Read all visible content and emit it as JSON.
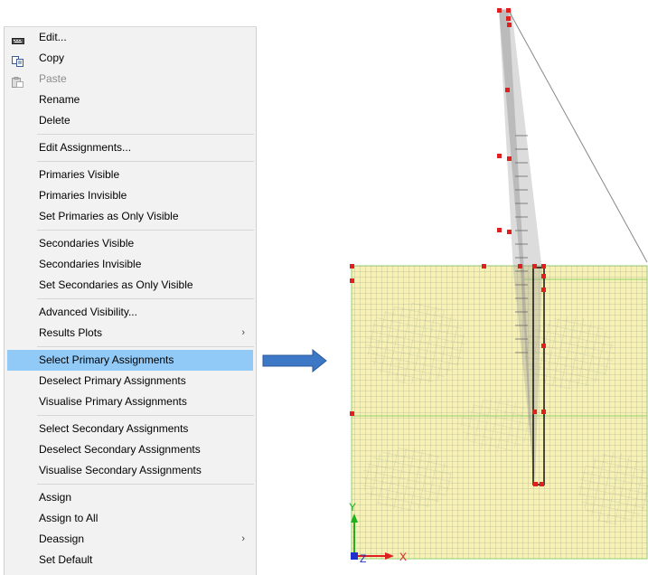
{
  "context_menu": {
    "items": [
      {
        "label": "Edit...",
        "icon": "keyboard-icon"
      },
      {
        "label": "Copy",
        "icon": "copy-icon"
      },
      {
        "label": "Paste",
        "icon": "paste-icon",
        "disabled": true
      },
      {
        "label": "Rename"
      },
      {
        "label": "Delete"
      },
      {
        "label": "Edit Assignments..."
      },
      {
        "label": "Primaries Visible"
      },
      {
        "label": "Primaries Invisible"
      },
      {
        "label": "Set Primaries as Only Visible"
      },
      {
        "label": "Secondaries Visible"
      },
      {
        "label": "Secondaries Invisible"
      },
      {
        "label": "Set Secondaries as Only Visible"
      },
      {
        "label": "Advanced Visibility..."
      },
      {
        "label": "Results Plots",
        "submenu": true
      },
      {
        "label": "Select Primary Assignments",
        "highlighted": true
      },
      {
        "label": "Deselect Primary Assignments"
      },
      {
        "label": "Visualise Primary Assignments"
      },
      {
        "label": "Select Secondary Assignments"
      },
      {
        "label": "Deselect Secondary Assignments"
      },
      {
        "label": "Visualise Secondary Assignments"
      },
      {
        "label": "Assign"
      },
      {
        "label": "Assign to All"
      },
      {
        "label": "Deassign",
        "submenu": true
      },
      {
        "label": "Set Default"
      }
    ]
  },
  "model_view": {
    "axis_labels": {
      "x": "X",
      "y": "Y",
      "z": "Z"
    },
    "colors": {
      "mesh_fill": "#f7f2b4",
      "mesh_lines": "#9a9a88",
      "boundary": "#8fd06a",
      "selected_nodes": "#e0201e",
      "pile": "#111111",
      "arrow": "#3d78c6",
      "x_axis": "#e02020",
      "y_axis": "#1fb01f",
      "z_axis": "#2030d0"
    }
  }
}
